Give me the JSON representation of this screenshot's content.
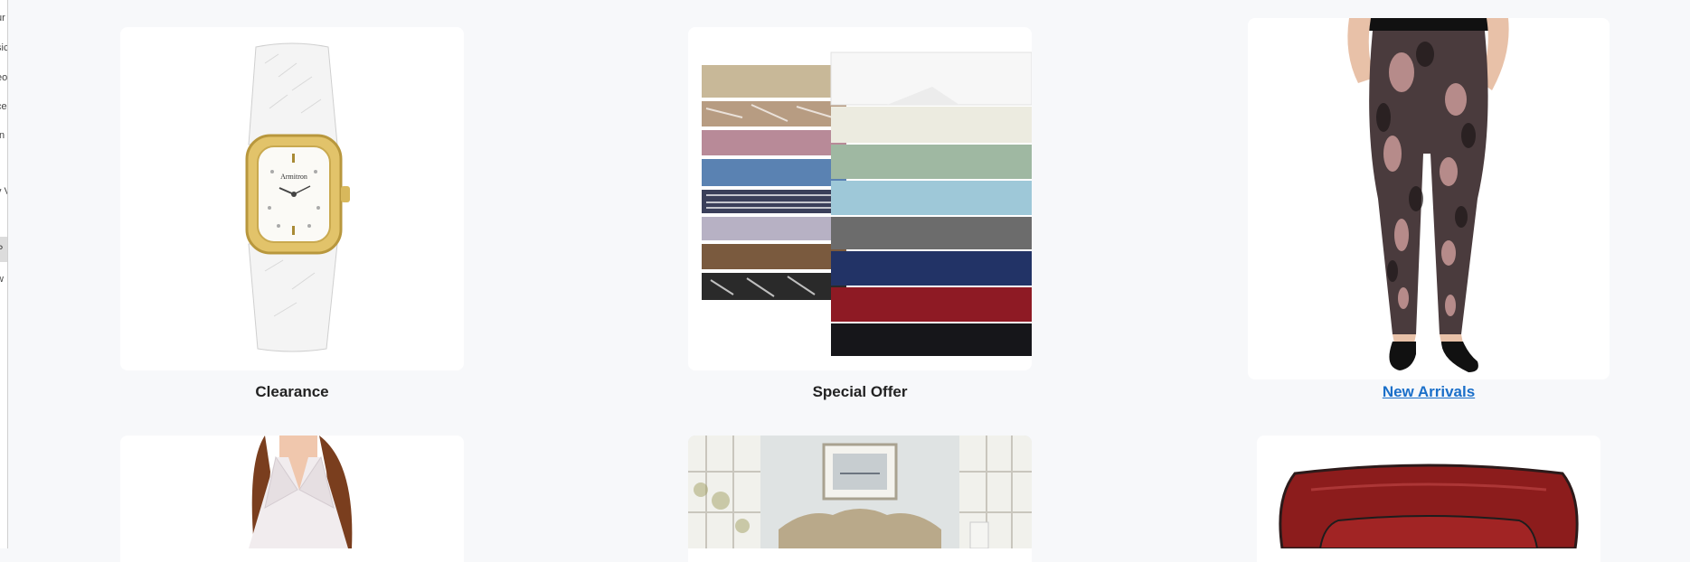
{
  "sidebar": {
    "fragments": [
      "ur",
      "sic",
      "eo",
      "ce",
      "In",
      "v V",
      "P",
      "w"
    ]
  },
  "products": [
    {
      "label": "Clearance",
      "image": "white-wristwatch-image",
      "link": false
    },
    {
      "label": "Special Offer",
      "image": "stacked-bedsheets-image",
      "link": false
    },
    {
      "label": "New Arrivals",
      "image": "patterned-leggings-image",
      "link": true
    },
    {
      "label": "",
      "image": "womens-blouse-image",
      "link": false
    },
    {
      "label": "",
      "image": "upholstered-headboard-bedroom-image",
      "link": false
    },
    {
      "label": "",
      "image": "red-square-plate-image",
      "link": false
    }
  ],
  "colors": {
    "page_bg": "#f7f8fa",
    "tile_bg": "#ffffff",
    "caption": "#222222",
    "link": "#1a6fc9"
  }
}
